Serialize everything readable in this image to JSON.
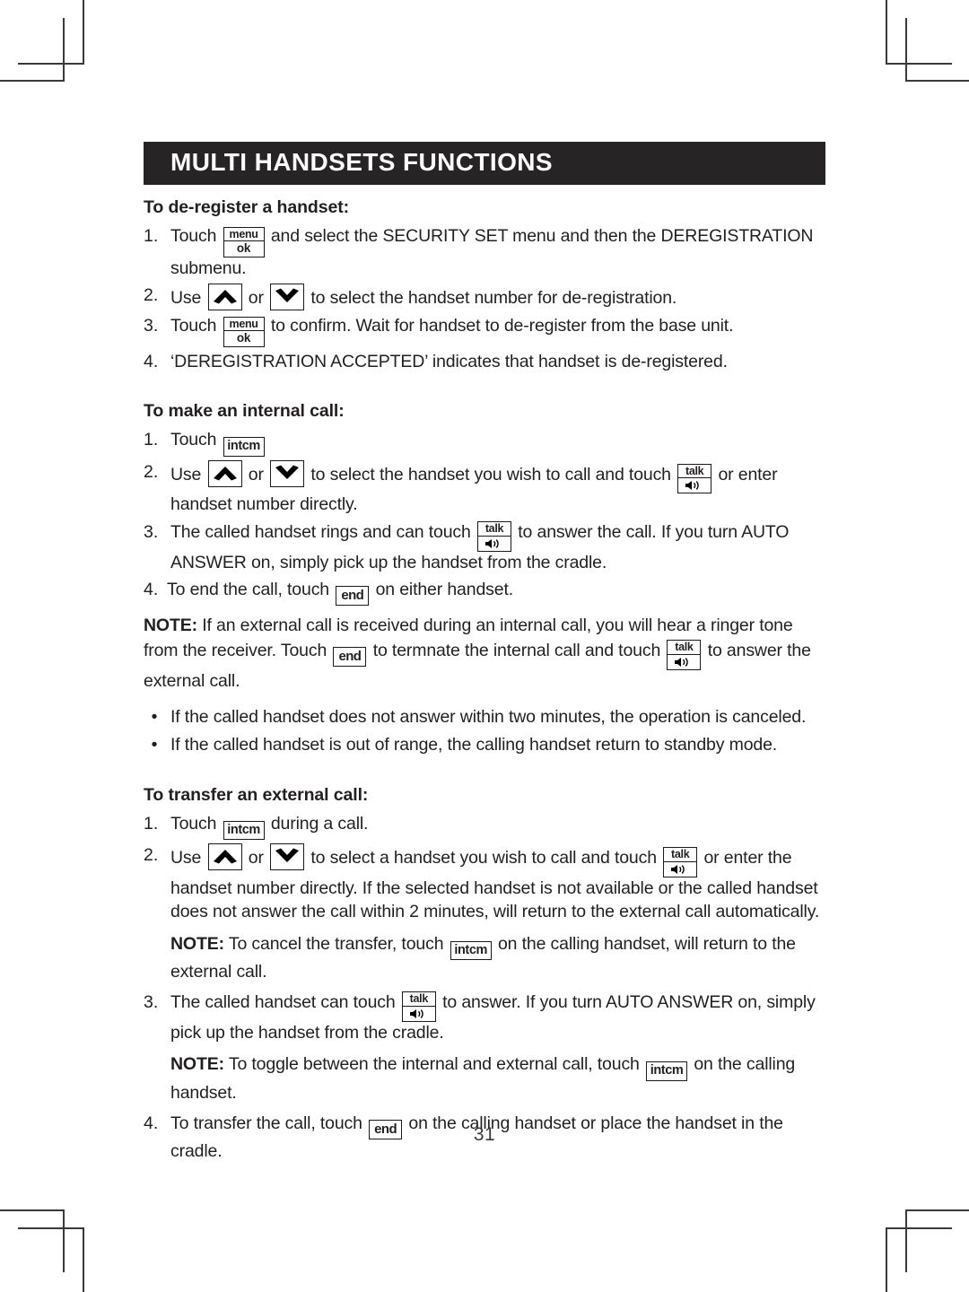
{
  "document": {
    "section_title": "MULTI HANDSETS FUNCTIONS",
    "page_number": "31"
  },
  "keys": {
    "menu_ok": {
      "top": "menu",
      "bottom": "ok"
    },
    "talk": {
      "top": "talk",
      "bottom": "speaker-icon"
    },
    "intcm": {
      "label": "intcm"
    },
    "end": {
      "label": "end"
    },
    "up": {
      "label": "chevron-up-icon"
    },
    "down": {
      "label": "chevron-down-icon"
    }
  },
  "sections": {
    "deregister": {
      "heading": "To de-register a handset:",
      "items": {
        "one": {
          "marker": "1.",
          "a": "Touch",
          "b": "and select the SECURITY SET menu and then the DEREGISTRATION submenu."
        },
        "two": {
          "marker": "2.",
          "a": "Use",
          "b": "or",
          "c": "to select the handset number for de-registration."
        },
        "three": {
          "marker": "3.",
          "a": "Touch",
          "b": "to confirm. Wait for handset to de-register from the base unit."
        },
        "four": {
          "marker": "4.",
          "a": "‘DEREGISTRATION ACCEPTED’ indicates that handset is de-registered."
        }
      }
    },
    "internal_call": {
      "heading": "To make an internal call:",
      "items": {
        "one": {
          "marker": "1.",
          "a": "Touch"
        },
        "two": {
          "marker": "2.",
          "a": "Use",
          "b": "or",
          "c": "to select the handset you wish to call and touch",
          "d": "or enter handset number directly."
        },
        "three": {
          "marker": "3.",
          "a": "The called handset rings and can touch",
          "b": "to answer the call. If you turn AUTO ANSWER on, simply pick up the handset from the cradle."
        },
        "four": {
          "marker": "4.",
          "a": "To end the call, touch",
          "b": "on either handset."
        }
      },
      "note": {
        "label": "NOTE:",
        "a": "If an external call is received during an internal call, you will hear a ringer tone from the receiver. Touch",
        "b": "to termnate the internal call and touch",
        "c": "to answer the external call."
      },
      "bullets": {
        "marker": "•",
        "one": "If the called handset does not answer within two minutes, the operation is canceled.",
        "two": "If the called handset is out of range, the calling handset return to standby mode."
      }
    },
    "transfer_call": {
      "heading": "To transfer an external call:",
      "items": {
        "one": {
          "marker": "1.",
          "a": "Touch",
          "b": "during a call."
        },
        "two": {
          "marker": "2.",
          "a": "Use",
          "b": "or",
          "c": "to select a handset you wish to call and touch",
          "d": "or enter the handset number directly. If the selected handset is not available or the called handset does not answer the call within 2 minutes, will return to the external call automatically."
        },
        "note_cancel": {
          "label": "NOTE:",
          "a": "To cancel the transfer, touch",
          "b": "on the calling handset, will return to the external call."
        },
        "three": {
          "marker": "3.",
          "a": "The called handset can touch",
          "b": "to answer. If you turn AUTO ANSWER on, simply pick up the handset from the cradle."
        },
        "note_toggle": {
          "label": "NOTE:",
          "a": "To toggle between the internal and external call, touch",
          "b": "on the calling handset."
        },
        "four": {
          "marker": "4.",
          "a": "To transfer the call, touch",
          "b": "on the calling handset or place the handset in the cradle."
        }
      }
    }
  }
}
